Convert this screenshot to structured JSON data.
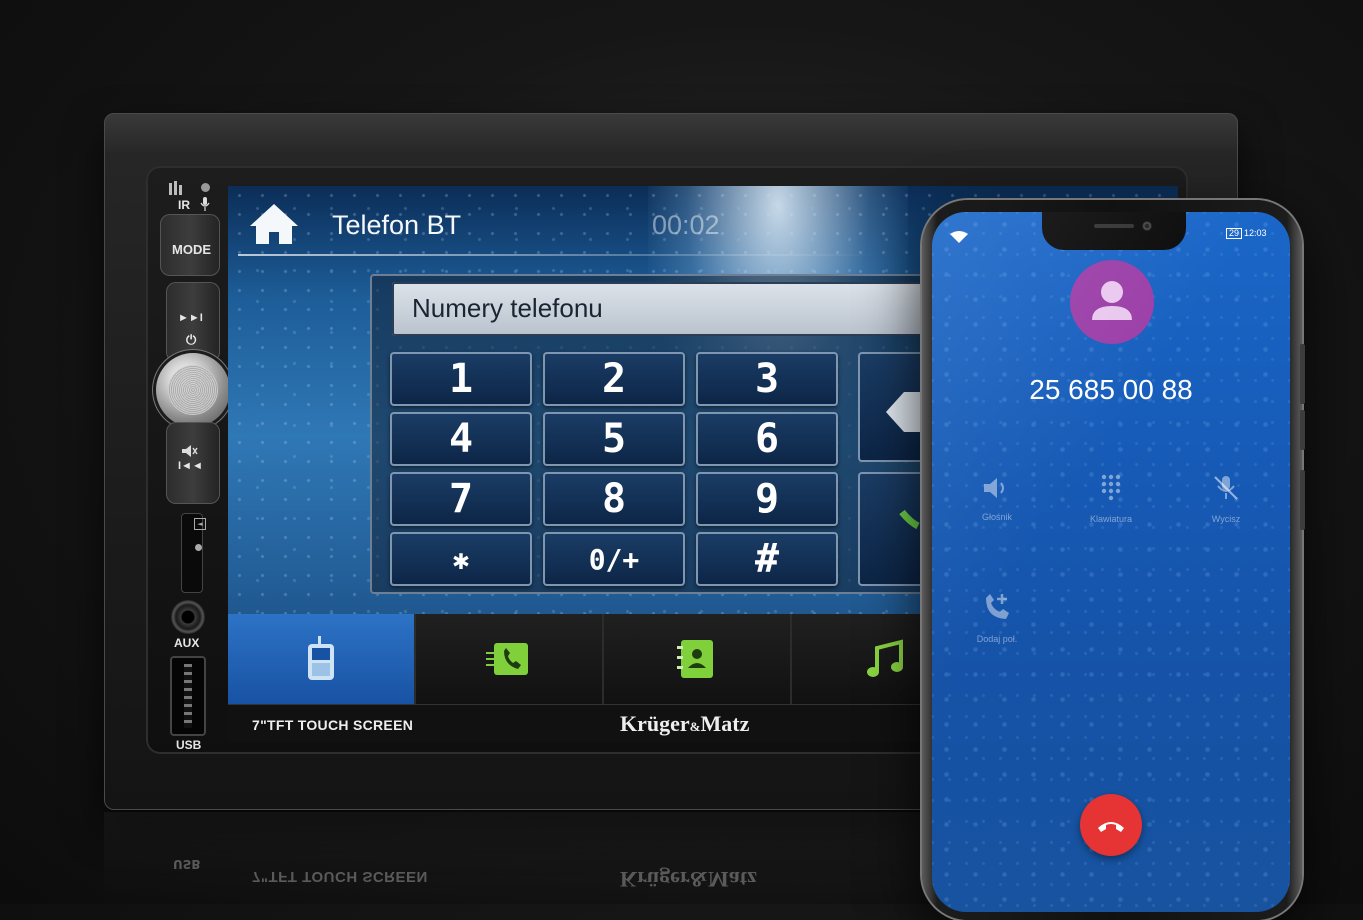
{
  "head_unit": {
    "buttons": {
      "ir_label": "IR",
      "mode_label": "MODE",
      "next_label": "►►I",
      "power_label": "⏻",
      "prev_label": "I◄◄",
      "aux_label": "AUX",
      "usb_label": "USB"
    },
    "screen": {
      "title": "Telefon BT",
      "timer": "00:02",
      "number_field_placeholder": "Numery telefonu",
      "keypad": [
        "1",
        "2",
        "3",
        "4",
        "5",
        "6",
        "7",
        "8",
        "9",
        "✱",
        "0/+",
        "#"
      ],
      "tabs": [
        {
          "icon": "mobile-phone-icon",
          "active": true
        },
        {
          "icon": "call-log-icon",
          "active": false
        },
        {
          "icon": "contacts-book-icon",
          "active": false
        },
        {
          "icon": "music-note-icon",
          "active": false
        }
      ]
    },
    "caption_left": "7\"TFT TOUCH SCREEN",
    "brand_main": "Krüger",
    "brand_amp": "&",
    "brand_end": "Matz",
    "colors": {
      "screen_blue": "#2f78b6",
      "tab_active": "#1852a3",
      "green_icon": "#7fd03a"
    }
  },
  "phone": {
    "status": {
      "battery": "29",
      "time": "12:03"
    },
    "number": "25 685 00 88",
    "controls": [
      {
        "icon": "speaker-icon",
        "label": "Głośnik"
      },
      {
        "icon": "keypad-icon",
        "label": "Klawiatura"
      },
      {
        "icon": "mic-off-icon",
        "label": "Wycisz"
      },
      {
        "icon": "add-call-icon",
        "label": "Dodaj poł."
      }
    ],
    "colors": {
      "background": "#1659b4",
      "avatar": "#9b3fa8",
      "hangup": "#e63333"
    }
  }
}
